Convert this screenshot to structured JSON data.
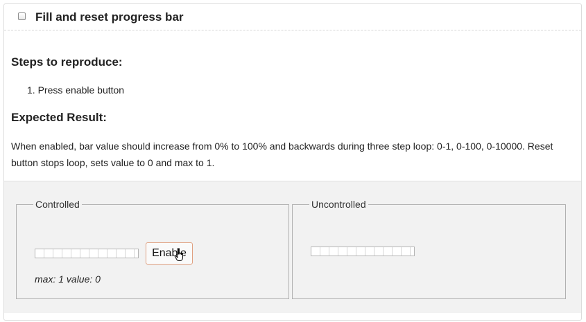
{
  "header": {
    "checkbox_checked": false,
    "title": "Fill and reset progress bar"
  },
  "steps": {
    "heading": "Steps to reproduce:",
    "items": [
      "1. Press enable button"
    ]
  },
  "expected": {
    "heading": "Expected Result:",
    "text": "When enabled, bar value should increase from 0% to 100% and backwards during three step loop: 0-1, 0-100, 0-10000. Reset button stops loop, sets value to 0 and max to 1."
  },
  "controlled": {
    "legend": "Controlled",
    "button_label": "Enable",
    "status": "max: 1 value: 0",
    "progress_value": 0,
    "progress_max": 1
  },
  "uncontrolled": {
    "legend": "Uncontrolled",
    "progress_value": 0
  },
  "icons": {
    "cursor": "hand-pointer-icon"
  },
  "colors": {
    "demo_background": "#f2f2f2",
    "button_border": "#e0a080"
  }
}
